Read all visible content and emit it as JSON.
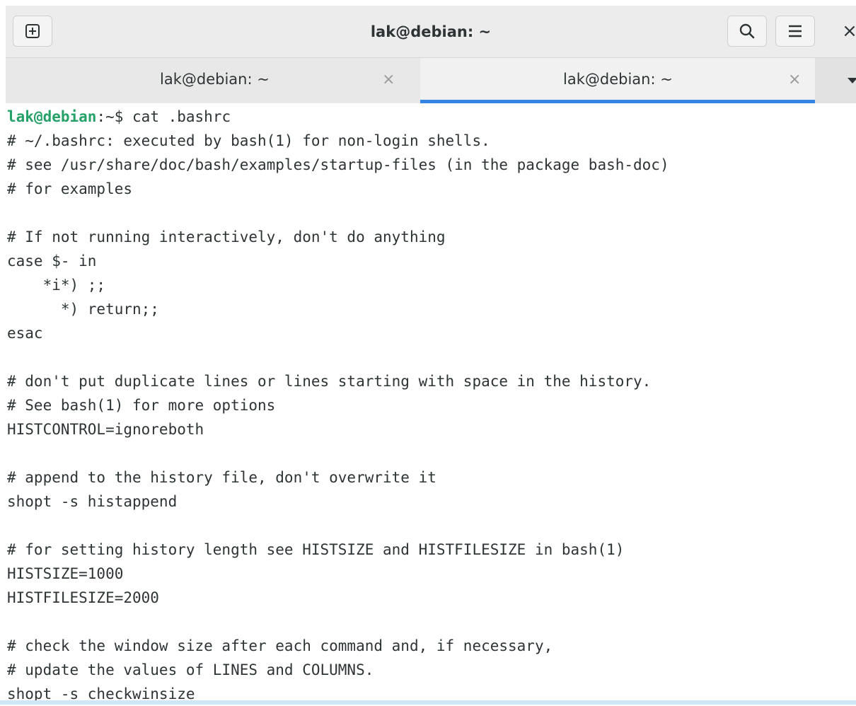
{
  "window": {
    "title": "lak@debian: ~",
    "icons": {
      "new_tab": "new-tab-icon",
      "search": "search-icon",
      "menu": "hamburger-menu-icon",
      "close": "close-icon",
      "tab_dropdown": "chevron-down-icon"
    }
  },
  "tabs": [
    {
      "label": "lak@debian: ~",
      "close": "×",
      "active": false
    },
    {
      "label": "lak@debian: ~",
      "close": "×",
      "active": true
    }
  ],
  "colors": {
    "prompt_user": "#26a269",
    "active_tab_indicator": "#3584e4",
    "text": "#2e3436"
  },
  "terminal": {
    "prompt": {
      "user_host": "lak@debian",
      "path": ":~",
      "symbol": "$ ",
      "command": "cat .bashrc"
    },
    "lines": [
      "# ~/.bashrc: executed by bash(1) for non-login shells.",
      "# see /usr/share/doc/bash/examples/startup-files (in the package bash-doc)",
      "# for examples",
      "",
      "# If not running interactively, don't do anything",
      "case $- in",
      "    *i*) ;;",
      "      *) return;;",
      "esac",
      "",
      "# don't put duplicate lines or lines starting with space in the history.",
      "# See bash(1) for more options",
      "HISTCONTROL=ignoreboth",
      "",
      "# append to the history file, don't overwrite it",
      "shopt -s histappend",
      "",
      "# for setting history length see HISTSIZE and HISTFILESIZE in bash(1)",
      "HISTSIZE=1000",
      "HISTFILESIZE=2000",
      "",
      "# check the window size after each command and, if necessary,",
      "# update the values of LINES and COLUMNS.",
      "shopt -s checkwinsize"
    ]
  }
}
